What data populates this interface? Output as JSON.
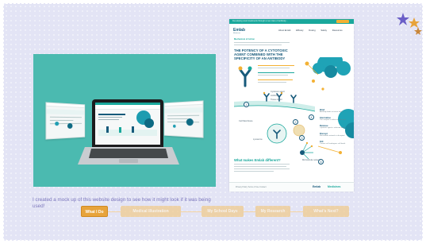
{
  "caption": "I created a mock up of this website design to see how it might look if it was being used!",
  "poster": {
    "topbar_text": "Developing novel treatments through a new class of antibody...",
    "logo": "Emlab",
    "logo_sub": "Medicines",
    "nav_items": [
      "About Emlab",
      "Efficacy",
      "Dosing",
      "Safety",
      "Resources"
    ],
    "mechanism_label": "Mechanism of Action",
    "headline": "THE POTENCY OF A CYTOTOXIC AGENT COMBINED WITH THE SPECIFICITY OF AN ANTIBODY",
    "labels": [
      "Cytotoxic agent",
      "Antibody",
      "Tissue factor",
      "Cell Membrane",
      "Lysosome",
      "Microtubule network"
    ],
    "legend": [
      {
        "title": "Bind",
        "text": "Antibody binds to tissue factor"
      },
      {
        "title": "Internalise",
        "text": "The complex is taken into the cell"
      },
      {
        "title": "Release",
        "text": "Cytotoxic agent is released inside"
      },
      {
        "title": "Disrupt",
        "text": "Microtubule network is disrupted"
      },
      {
        "title": "Kill",
        "text": "Tumour cell undergoes cell death"
      }
    ],
    "subheadline": "What makes Emlab different?",
    "footer_links": "Privacy Policy   Terms of Use   Contact",
    "footer_brand_1": "Emlab",
    "footer_brand_2": "Medicines",
    "colors": {
      "teal": "#1aa89c",
      "navy": "#175a7b",
      "gold": "#f3b134"
    }
  },
  "tabs": [
    {
      "label": "What I Do",
      "active": true
    },
    {
      "label": "Medical Illustration",
      "active": false
    },
    {
      "label": "My School Days",
      "active": false
    },
    {
      "label": "My Research",
      "active": false
    },
    {
      "label": "What's Next?",
      "active": false
    }
  ],
  "decorations": [
    "stars-icon"
  ]
}
